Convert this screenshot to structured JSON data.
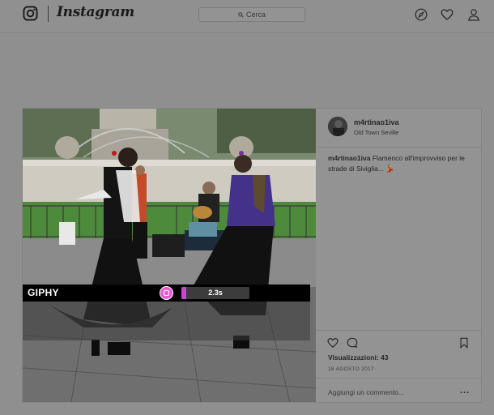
{
  "header": {
    "app_name": "Instagram",
    "search_placeholder": "Cerca",
    "icons": [
      "instagram-camera-icon",
      "explore-compass-icon",
      "activity-heart-icon",
      "profile-icon"
    ]
  },
  "post": {
    "username": "m4rtinao1iva",
    "location": "Old Town Seville",
    "caption_user": "m4rtinao1iva",
    "caption_text": "Flamenco all'improvviso per le strade di Siviglia... 💃",
    "views": "Visualizzazioni: 43",
    "date": "18 AGOSTO 2017",
    "comment_placeholder": "Aggiungi un commento...",
    "more_label": "..."
  },
  "giphy": {
    "label": "GIPHY",
    "duration": "2.3s",
    "progress": 0.07,
    "accent_color": "#e55cd3"
  }
}
